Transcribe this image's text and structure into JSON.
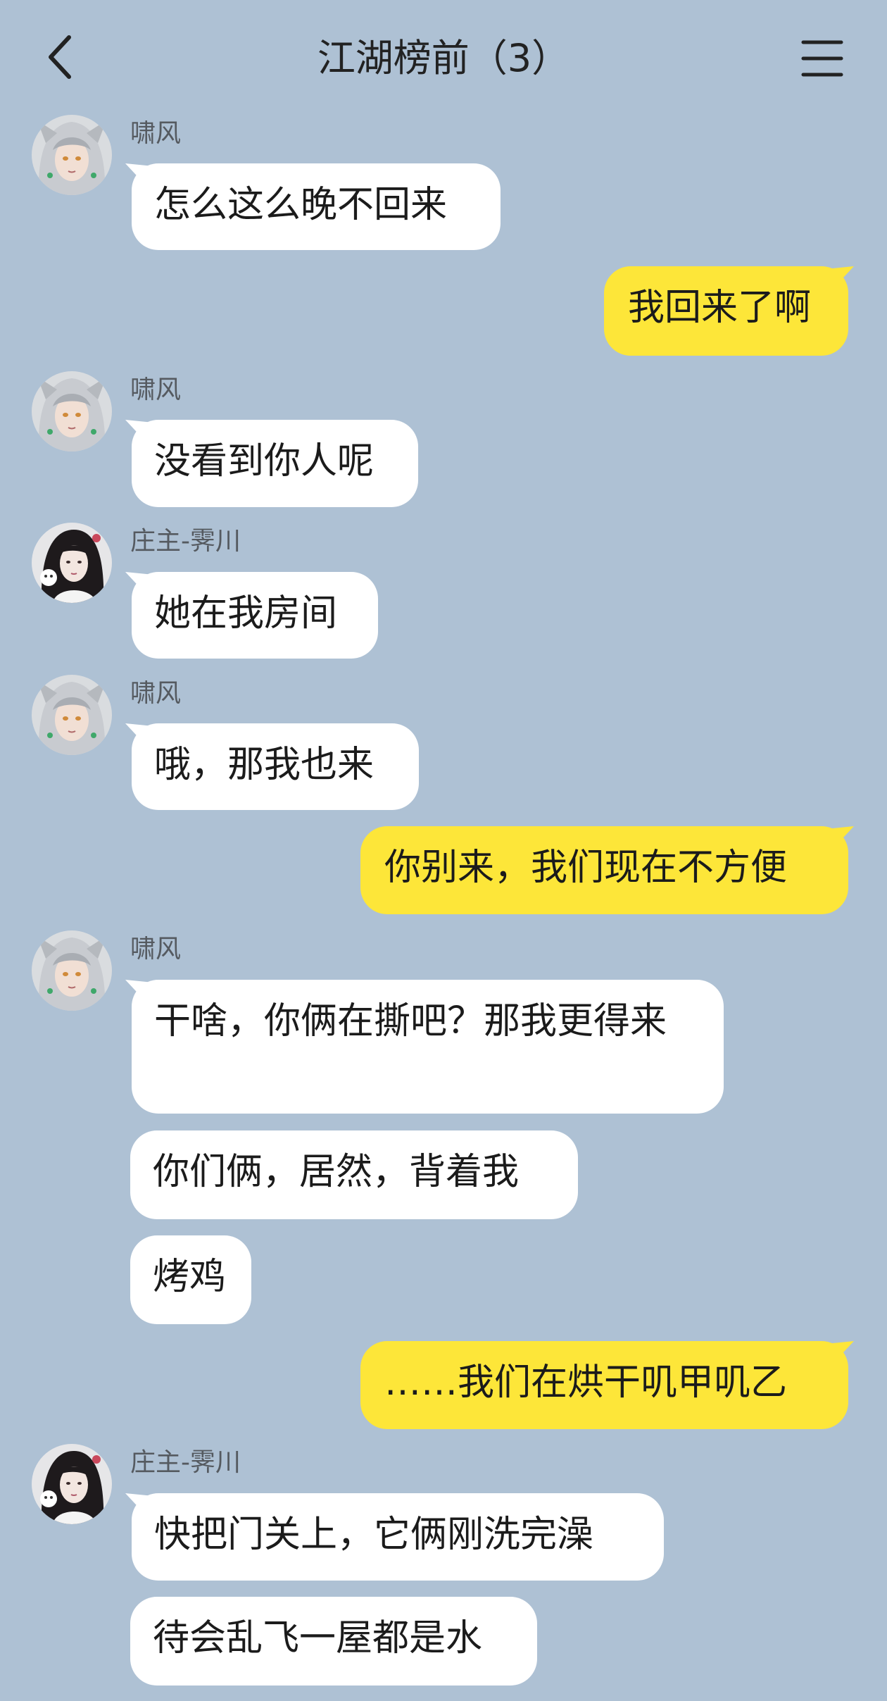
{
  "header": {
    "title": "江湖榜前（3）"
  },
  "icons": {
    "back": "chevron-left-icon",
    "menu": "hamburger-menu-icon"
  },
  "colors": {
    "background": "#aec1d4",
    "incoming_bubble": "#ffffff",
    "outgoing_bubble": "#fde639"
  },
  "messages": [
    {
      "side": "left",
      "sender": "啸风",
      "text": "怎么这么晚不回来"
    },
    {
      "side": "right",
      "text": "我回来了啊"
    },
    {
      "side": "left",
      "sender": "啸风",
      "text": "没看到你人呢"
    },
    {
      "side": "left",
      "sender": "庄主-霁川",
      "text": "她在我房间"
    },
    {
      "side": "left",
      "sender": "啸风",
      "text": "哦，那我也来"
    },
    {
      "side": "right",
      "text": "你别来，我们现在不方便"
    },
    {
      "side": "left",
      "sender": "啸风",
      "text": "干啥，你俩在撕吧？那我更得来"
    },
    {
      "side": "left",
      "text": "你们俩，居然，背着我"
    },
    {
      "side": "left",
      "text": "烤鸡"
    },
    {
      "side": "right",
      "text": "……我们在烘干叽甲叽乙"
    },
    {
      "side": "left",
      "sender": "庄主-霁川",
      "text": "快把门关上，它俩刚洗完澡"
    },
    {
      "side": "left",
      "text": "待会乱飞一屋都是水"
    }
  ]
}
